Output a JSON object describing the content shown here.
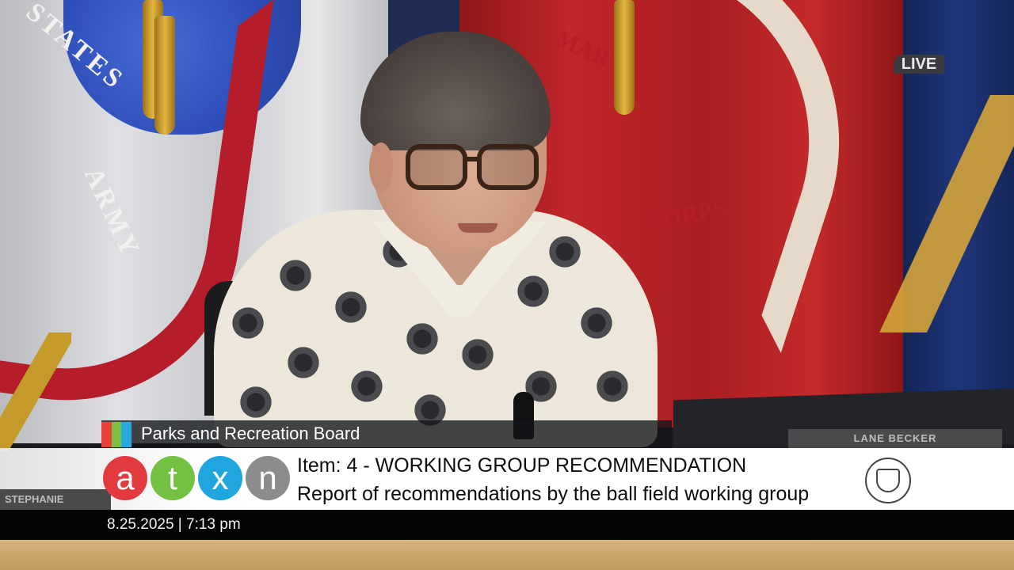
{
  "background": {
    "army_flag_text": "STATES ARMY",
    "marine_flag_text": "MARINE CORPS",
    "live_badge": "LIVE",
    "name_plates": [
      "LANE BECKER",
      "STEPHANIE"
    ]
  },
  "lower_third": {
    "board_title": "Parks and Recreation Board",
    "color_blocks": [
      "#e8413c",
      "#7ac143",
      "#29a8e0"
    ],
    "logo_letters": [
      {
        "letter": "a",
        "color": "#e23a3f"
      },
      {
        "letter": "t",
        "color": "#74c043"
      },
      {
        "letter": "x",
        "color": "#1fa6df"
      },
      {
        "letter": "n",
        "color": "#8c8c8f"
      }
    ],
    "item_title": "Item: 4 - WORKING GROUP RECOMMENDATION",
    "item_description": "Report of recommendations by the ball field working group",
    "seal_name": "city-of-austin-seal",
    "timestamp": "8.25.2025 | 7:13 pm"
  }
}
